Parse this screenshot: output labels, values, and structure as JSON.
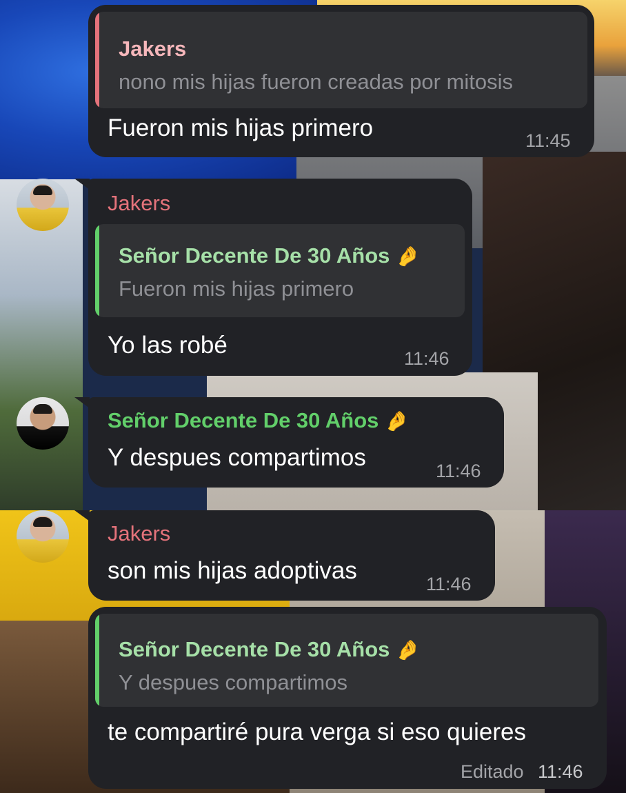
{
  "messages": [
    {
      "quote": {
        "name": "Jakers",
        "text": "nono mis hijas fueron creadas por mitosis"
      },
      "text": "Fueron mis hijas primero",
      "time": "11:45"
    },
    {
      "sender": "Jakers",
      "quote": {
        "name": "Señor Decente De 30 Años",
        "emoji": "🤌",
        "text": "Fueron mis hijas primero"
      },
      "text": "Yo las robé",
      "time": "11:46"
    },
    {
      "sender": "Señor Decente De 30 Años",
      "sender_emoji": "🤌",
      "text": "Y despues compartimos",
      "time": "11:46"
    },
    {
      "sender": "Jakers",
      "text": "son mis hijas adoptivas",
      "time": "11:46"
    },
    {
      "quote": {
        "name": "Señor Decente De 30 Años",
        "emoji": "🤌",
        "text": "Y despues compartimos"
      },
      "text": "te compartiré pura verga si eso quieres",
      "edited": "Editado",
      "time": "11:46"
    }
  ],
  "colors": {
    "bubble": "#212226",
    "quote_bg": "#303134",
    "jakers": "#e5737b",
    "jakers_quote_name": "#f6b7bb",
    "senor": "#62cf6a",
    "senor_quote_name": "#a6e0a8",
    "muted": "#a3a4a8"
  },
  "icons": [
    "pinched-fingers-emoji",
    "avatar-jakers",
    "avatar-senor-decente"
  ]
}
